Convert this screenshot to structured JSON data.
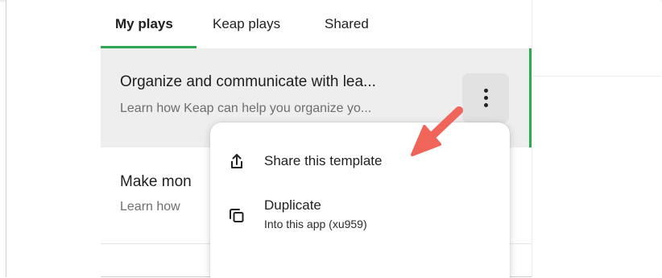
{
  "tabs": [
    {
      "label": "My plays",
      "active": true
    },
    {
      "label": "Keap plays",
      "active": false
    },
    {
      "label": "Shared",
      "active": false
    }
  ],
  "plays": [
    {
      "title": "Organize and communicate with lea...",
      "description": "Learn how Keap can help you organize yo..."
    },
    {
      "title": "Make mon",
      "description": "Learn how"
    }
  ],
  "menu": {
    "share": {
      "label": "Share this template",
      "icon": "share-icon"
    },
    "duplicate": {
      "label": "Duplicate",
      "sub": "Into this app (xu959)",
      "icon": "copy-icon"
    }
  },
  "colors": {
    "accent": "#2fa84f",
    "annotation_arrow": "#f0655a"
  }
}
